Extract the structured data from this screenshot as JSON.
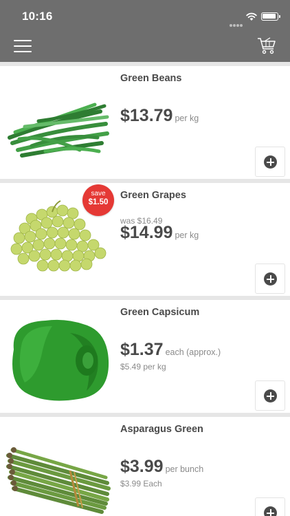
{
  "status_bar": {
    "time": "10:16"
  },
  "header": {
    "menu_icon": "hamburger-menu-icon",
    "cart_icon": "cart-icon"
  },
  "colors": {
    "header_bg": "#6e6e6e",
    "save_badge": "#e53935",
    "text": "#4a4a4a",
    "muted": "#8a8a8a"
  },
  "products": [
    {
      "name": "Green Beans",
      "price": "$13.79",
      "unit": "per kg",
      "image": "green-beans"
    },
    {
      "name": "Green Grapes",
      "was": "was $16.49",
      "price": "$14.99",
      "unit": "per kg",
      "save_label": "save",
      "save_amount": "$1.50",
      "image": "green-grapes"
    },
    {
      "name": "Green Capsicum",
      "price": "$1.37",
      "unit": "each (approx.)",
      "sub": "$5.49 per kg",
      "image": "green-capsicum"
    },
    {
      "name": "Asparagus Green",
      "price": "$3.99",
      "unit": "per bunch",
      "sub": "$3.99 Each",
      "image": "asparagus"
    }
  ]
}
